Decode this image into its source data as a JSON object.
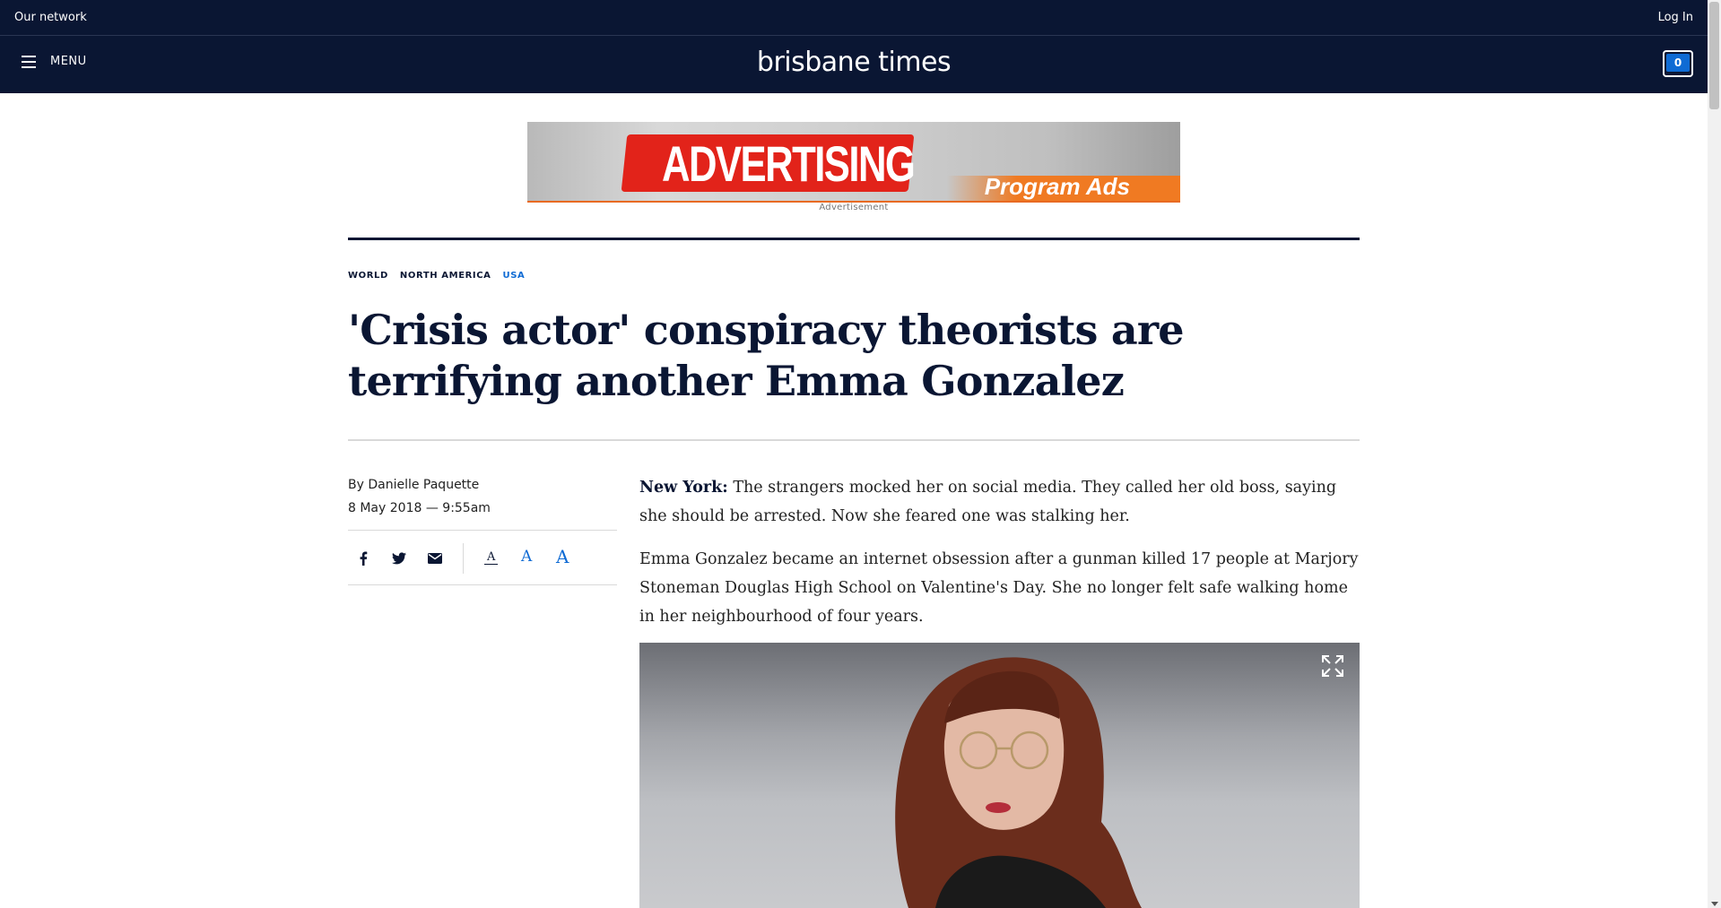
{
  "netbar": {
    "left": "Our network",
    "right": "Log In"
  },
  "masthead": {
    "menu_label": "MENU",
    "logo": "brisbane times",
    "cart_count": "0"
  },
  "ad": {
    "headline": "ADVERTISING",
    "sub": "Program Ads",
    "label": "Advertisement"
  },
  "breadcrumbs": [
    {
      "label": "WORLD"
    },
    {
      "label": "NORTH AMERICA"
    },
    {
      "label": "USA"
    }
  ],
  "article": {
    "headline": "'Crisis actor' conspiracy theorists are terrifying another Emma Gonzalez",
    "author": "By Danielle Paquette",
    "date": "8 May 2018 — 9:55am",
    "dateline": "New York:",
    "p1": " The strangers mocked her on social media. They called her old boss, saying she should be arrested. Now she feared one was stalking her.",
    "p2": "Emma Gonzalez became an internet obsession after a gunman killed 17 people at Marjory Stoneman Douglas High School on Valentine's Day. She no longer felt safe walking home in her neighbourhood of four years."
  },
  "font_size_controls": [
    "A",
    "A",
    "A"
  ],
  "colors": {
    "navy": "#0a1633",
    "accent": "#0f6bd4"
  }
}
